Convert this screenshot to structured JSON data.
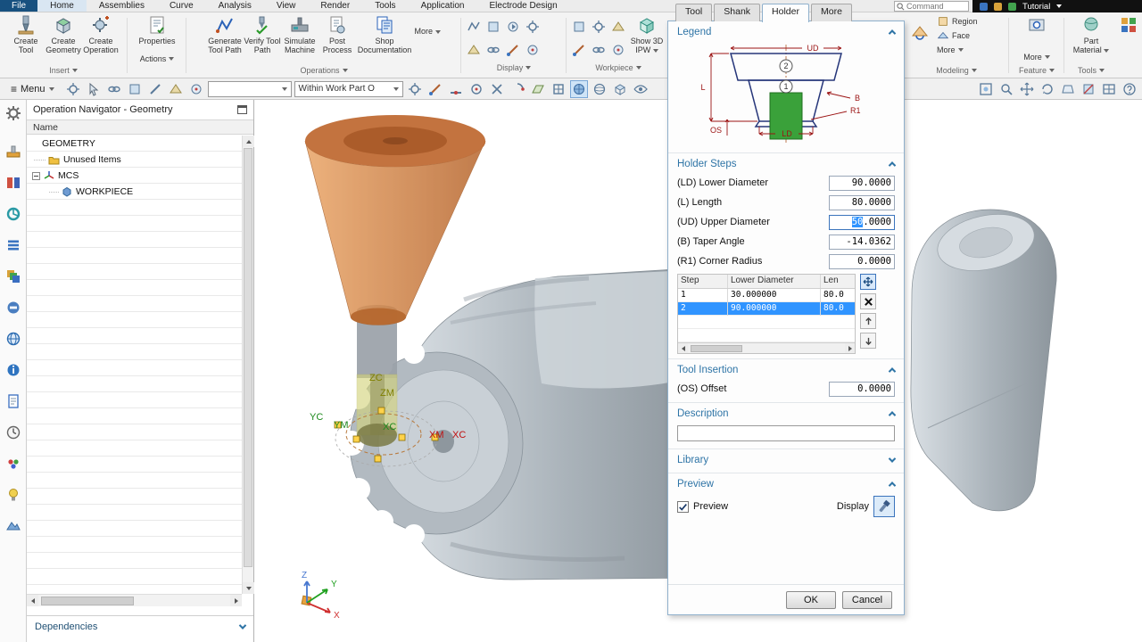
{
  "titlebar": {
    "file_tab": "File",
    "tabs": [
      "Home",
      "Assemblies",
      "Curve",
      "Analysis",
      "View",
      "Render",
      "Tools",
      "Application",
      "Electrode Design"
    ],
    "active_tab": "Home",
    "command_placeholder": "Command",
    "tutorial_label": "Tutorial"
  },
  "ribbon": {
    "insert_group": {
      "label": "Insert",
      "buttons": [
        {
          "label": "Create Tool"
        },
        {
          "label": "Create Geometry"
        },
        {
          "label": "Create Operation"
        }
      ]
    },
    "properties_button": "Properties",
    "actions_menu": "Actions",
    "operations_group": {
      "label": "Operations",
      "buttons": [
        {
          "label": "Generate Tool Path"
        },
        {
          "label": "Verify Tool Path"
        },
        {
          "label": "Simulate Machine"
        },
        {
          "label": "Post Process"
        },
        {
          "label": "Shop Documentation"
        },
        {
          "label": "More"
        }
      ]
    },
    "display_group": {
      "label": "Display"
    },
    "workpiece_group": {
      "label": "Workpiece",
      "show_3d_ipw": "Show 3D IPW"
    },
    "modeling_group": {
      "label": "Modeling",
      "region": "Region",
      "face": "Face",
      "more": "More"
    },
    "feature_group": {
      "label": "Feature",
      "more": "More"
    },
    "tools_group": {
      "label": "Tools",
      "part_material": "Part Material"
    }
  },
  "toolbar": {
    "menu": "Menu",
    "filter_value": "",
    "scope_value": "Within Work Part O"
  },
  "navigator": {
    "title": "Operation Navigator - Geometry",
    "column_header": "Name",
    "rows": [
      {
        "label": "GEOMETRY"
      },
      {
        "label": "Unused Items"
      },
      {
        "label": "MCS"
      },
      {
        "label": "WORKPIECE"
      }
    ],
    "dependencies": "Dependencies"
  },
  "viewport": {
    "axis_labels": {
      "zc": "ZC",
      "zm": "ZM",
      "yc": "YC",
      "ym": "YM",
      "xc_green": "XC",
      "xm": "XM",
      "xc_red": "XC"
    },
    "triad": {
      "x": "X",
      "y": "Y",
      "z": "Z"
    }
  },
  "dialog": {
    "tabs": [
      {
        "label": "Tool"
      },
      {
        "label": "Shank"
      },
      {
        "label": "Holder"
      },
      {
        "label": "More"
      }
    ],
    "active_tab": "Holder",
    "legend": {
      "title": "Legend",
      "labels": {
        "ud": "UD",
        "l": "L",
        "os": "OS",
        "b": "B",
        "r1": "R1",
        "ld": "LD",
        "step1": "1",
        "step2": "2"
      }
    },
    "holder_steps": {
      "title": "Holder Steps",
      "fields": [
        {
          "label": "(LD) Lower Diameter",
          "value": "90.0000"
        },
        {
          "label": "(L) Length",
          "value": "80.0000"
        },
        {
          "label": "(UD) Upper Diameter",
          "value": "50.0000",
          "selected_text": "50",
          "rest_text": ".0000"
        },
        {
          "label": "(B) Taper Angle",
          "value": "-14.0362"
        },
        {
          "label": "(R1) Corner Radius",
          "value": "0.0000"
        }
      ],
      "table": {
        "columns": [
          "Step",
          "Lower Diameter",
          "Len"
        ],
        "rows": [
          {
            "step": "1",
            "lower_diameter": "30.000000",
            "length": "80.0"
          },
          {
            "step": "2",
            "lower_diameter": "90.000000",
            "length": "80.0"
          }
        ],
        "selected_step": "2"
      }
    },
    "tool_insertion": {
      "title": "Tool Insertion",
      "offset_label": "(OS) Offset",
      "offset_value": "0.0000"
    },
    "description": {
      "title": "Description",
      "value": ""
    },
    "library": {
      "title": "Library"
    },
    "preview": {
      "title": "Preview",
      "checkbox_label": "Preview",
      "display_label": "Display"
    },
    "buttons": {
      "ok": "OK",
      "cancel": "Cancel"
    }
  },
  "colors": {
    "selection_blue": "#3094ff",
    "section_title_blue": "#2e74a6",
    "holder_orange": "#d2834b",
    "legend_tool_green": "#3aa13a",
    "dimension_red": "#9b1313",
    "profile_navy": "#26367a"
  }
}
